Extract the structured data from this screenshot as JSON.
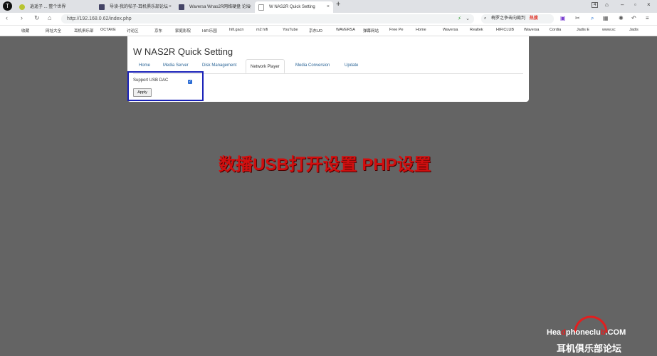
{
  "tabs": [
    {
      "label": "逍遥子 ... 整个世界",
      "active": false
    },
    {
      "label": "导读-我的帖子-耳机俱乐部论坛",
      "active": false
    },
    {
      "label": "Waversa Wnas2R网络硬盘 论坛",
      "active": false
    },
    {
      "label": "W NAS2R Quick Setting",
      "active": true
    }
  ],
  "tab_count": "4",
  "address": {
    "url": "http://192.168.0.62/index.php"
  },
  "search": {
    "text": "梅罗之争击向裁判",
    "hot_badge": "热搜"
  },
  "bookmarks": [
    "收藏",
    "网址大全",
    "耳机俱乐部",
    "OCTAVE",
    "讨论区",
    "京东",
    "家庭影院",
    "HiFi乐园",
    "hifi.gacn",
    "m2 hifi",
    "YouTube",
    "京东UD",
    "WAVERSA",
    "弹幕网站",
    "Free Pe",
    "Home",
    "Waversa",
    "Realtek",
    "HIFICLUB",
    "Waversa",
    "Cordia",
    "Jadis E",
    "www.sc",
    "Jadis"
  ],
  "page": {
    "title": "W NAS2R Quick Setting",
    "tabs": [
      "Home",
      "Media Server",
      "Disk Management",
      "Network Player",
      "Media Conversion",
      "Update"
    ],
    "active_tab": "Network Player",
    "support_usb_dac_label": "Support USB DAC",
    "support_usb_dac_checked": true,
    "apply_label": "Apply"
  },
  "annotation": {
    "caption": "数播USB打开设置 PHP设置",
    "highlight_color": "#1a22b8",
    "caption_color": "#d10f0f"
  },
  "watermark": {
    "line1_a": "Hea",
    "line1_b": "phoneclu",
    "line1_c": ".COM",
    "line2": "耳机俱乐部论坛"
  }
}
